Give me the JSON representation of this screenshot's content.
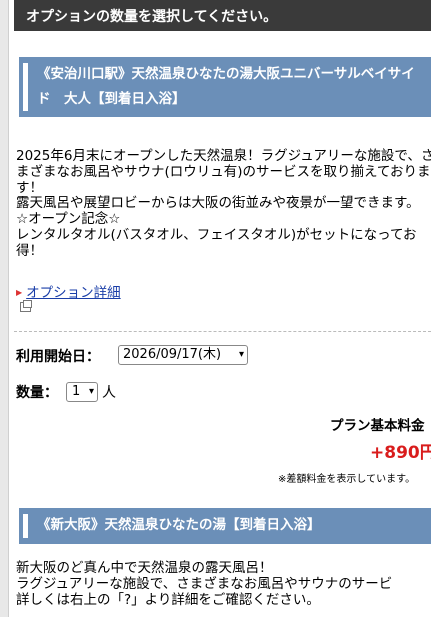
{
  "header": {
    "title": "オプションの数量を選択してください。"
  },
  "option1": {
    "title": "《安治川口駅》天然温泉ひなたの湯大阪ユニバーサルベイサイド　大人【到着日入浴】",
    "description": "2025年6月末にオープンした天然温泉！ラグジュアリーな施設で、さまざまなお風呂やサウナ(ロウリュ有)のサービスを取り揃えております！\n露天風呂や展望ロビーからは大阪の街並みや夜景が一望できます。\n☆オープン記念☆\nレンタルタオル(バスタオル、フェイスタオル)がセットになってお得！",
    "detail_link": "オプション詳細",
    "date_label": "利用開始日：",
    "date_value": "2026/09/17(木)",
    "qty_label": "数量：",
    "qty_value": "1",
    "qty_unit": "人",
    "price_title": "プラン基本料金",
    "price_value": "+890円",
    "price_note": "※差額料金を表示しています。"
  },
  "option2": {
    "title": "《新大阪》天然温泉ひなたの湯【到着日入浴】",
    "description": "新大阪のど真ん中で天然温泉の露天風呂！\nラグジュアリーな施設で、さまざまなお風呂やサウナのサービ\n詳しくは右上の「?」より詳細をご確認ください。"
  }
}
